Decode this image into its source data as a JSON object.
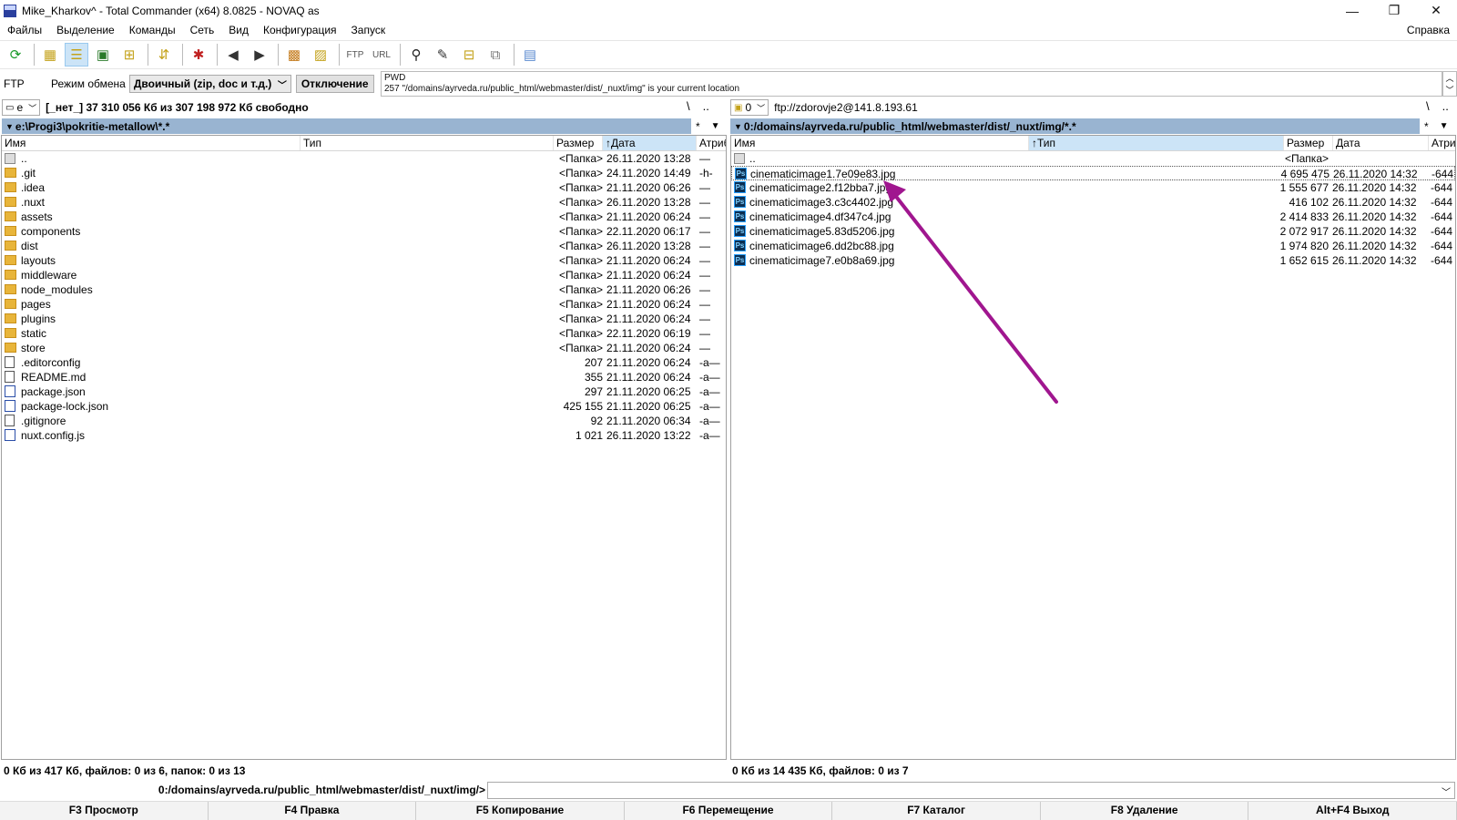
{
  "window": {
    "title": "Mike_Kharkov^ - Total Commander (x64) 8.0825 - NOVAQ as",
    "minimize": "—",
    "restore": "❐",
    "close": "✕"
  },
  "menu": {
    "items": [
      "Файлы",
      "Выделение",
      "Команды",
      "Сеть",
      "Вид",
      "Конфигурация",
      "Запуск"
    ],
    "help": "Справка"
  },
  "toolbar": {
    "icons": [
      "refresh-icon",
      "brief-view-icon",
      "full-view-icon",
      "thumbnails-icon",
      "tree-icon",
      "sync-icon",
      "pack-icon",
      "back-icon",
      "forward-icon",
      "pack-files-icon",
      "unpack-files-icon",
      "ftp-connect-icon",
      "url-connect-icon",
      "search-icon",
      "multi-rename-icon",
      "compare-dirs-icon",
      "sync-dirs-icon",
      "notepad-icon"
    ]
  },
  "ftp": {
    "label": "FTP",
    "mode_label": "Режим обмена",
    "mode_value": "Двоичный (zip, doc и т.д.)",
    "disconnect": "Отключение",
    "log_line1": "PWD",
    "log_line2": "257 \"/domains/ayrveda.ru/public_html/webmaster/dist/_nuxt/img\" is your current location"
  },
  "left": {
    "drive": "e",
    "drive_info": "[_нет_]  37 310 056 Кб из 307 198 972 Кб свободно",
    "nav_root": "\\",
    "nav_up": "..",
    "path": "e:\\Progi3\\pokritie-metallow\\*.*",
    "filter": "*",
    "filter_chev": "▼",
    "headers": {
      "name": "Имя",
      "type": "Тип",
      "size": "Размер",
      "date": "↑Дата",
      "attr": "Атриб"
    },
    "rows": [
      {
        "icon": "up",
        "name": "..",
        "type": "",
        "size": "<Папка>",
        "date": "26.11.2020 13:28",
        "attr": "—"
      },
      {
        "icon": "folder",
        "name": ".git",
        "type": "",
        "size": "<Папка>",
        "date": "24.11.2020 14:49",
        "attr": "-h-"
      },
      {
        "icon": "folder",
        "name": ".idea",
        "type": "",
        "size": "<Папка>",
        "date": "21.11.2020 06:26",
        "attr": "—"
      },
      {
        "icon": "folder",
        "name": ".nuxt",
        "type": "",
        "size": "<Папка>",
        "date": "26.11.2020 13:28",
        "attr": "—"
      },
      {
        "icon": "folder",
        "name": "assets",
        "type": "",
        "size": "<Папка>",
        "date": "21.11.2020 06:24",
        "attr": "—"
      },
      {
        "icon": "folder",
        "name": "components",
        "type": "",
        "size": "<Папка>",
        "date": "22.11.2020 06:17",
        "attr": "—"
      },
      {
        "icon": "folder",
        "name": "dist",
        "type": "",
        "size": "<Папка>",
        "date": "26.11.2020 13:28",
        "attr": "—"
      },
      {
        "icon": "folder",
        "name": "layouts",
        "type": "",
        "size": "<Папка>",
        "date": "21.11.2020 06:24",
        "attr": "—"
      },
      {
        "icon": "folder",
        "name": "middleware",
        "type": "",
        "size": "<Папка>",
        "date": "21.11.2020 06:24",
        "attr": "—"
      },
      {
        "icon": "folder",
        "name": "node_modules",
        "type": "",
        "size": "<Папка>",
        "date": "21.11.2020 06:26",
        "attr": "—"
      },
      {
        "icon": "folder",
        "name": "pages",
        "type": "",
        "size": "<Папка>",
        "date": "21.11.2020 06:24",
        "attr": "—"
      },
      {
        "icon": "folder",
        "name": "plugins",
        "type": "",
        "size": "<Папка>",
        "date": "21.11.2020 06:24",
        "attr": "—"
      },
      {
        "icon": "folder",
        "name": "static",
        "type": "",
        "size": "<Папка>",
        "date": "22.11.2020 06:19",
        "attr": "—"
      },
      {
        "icon": "folder",
        "name": "store",
        "type": "",
        "size": "<Папка>",
        "date": "21.11.2020 06:24",
        "attr": "—"
      },
      {
        "icon": "file",
        "name": ".editorconfig",
        "type": "",
        "size": "207",
        "date": "21.11.2020 06:24",
        "attr": "-a—"
      },
      {
        "icon": "file",
        "name": "README.md",
        "type": "",
        "size": "355",
        "date": "21.11.2020 06:24",
        "attr": "-a—"
      },
      {
        "icon": "json",
        "name": "package.json",
        "type": "",
        "size": "297",
        "date": "21.11.2020 06:25",
        "attr": "-a—"
      },
      {
        "icon": "json",
        "name": "package-lock.json",
        "type": "",
        "size": "425 155",
        "date": "21.11.2020 06:25",
        "attr": "-a—"
      },
      {
        "icon": "file",
        "name": ".gitignore",
        "type": "",
        "size": "92",
        "date": "21.11.2020 06:34",
        "attr": "-a—"
      },
      {
        "icon": "json",
        "name": "nuxt.config.js",
        "type": "",
        "size": "1 021",
        "date": "26.11.2020 13:22",
        "attr": "-a—"
      }
    ],
    "status": "0 Кб из 417 Кб, файлов: 0 из 6, папок: 0 из 13"
  },
  "right": {
    "drive": "0",
    "drive_info": "ftp://zdorovje2@141.8.193.61",
    "nav_root": "\\",
    "nav_up": "..",
    "path": "0:/domains/ayrveda.ru/public_html/webmaster/dist/_nuxt/img/*.*",
    "filter": "*",
    "filter_chev": "▼",
    "headers": {
      "name": "Имя",
      "type": "↑Тип",
      "size": "Размер",
      "date": "Дата",
      "attr": "Атриб"
    },
    "rows": [
      {
        "icon": "up",
        "name": "..",
        "type": "",
        "size": "<Папка>",
        "date": "",
        "attr": ""
      },
      {
        "icon": "ps",
        "name": "cinematicimage1.7e09e83.jpg",
        "type": "",
        "size": "4 695 475",
        "date": "26.11.2020 14:32",
        "attr": "-644"
      },
      {
        "icon": "ps",
        "name": "cinematicimage2.f12bba7.jpg",
        "type": "",
        "size": "1 555 677",
        "date": "26.11.2020 14:32",
        "attr": "-644"
      },
      {
        "icon": "ps",
        "name": "cinematicimage3.c3c4402.jpg",
        "type": "",
        "size": "416 102",
        "date": "26.11.2020 14:32",
        "attr": "-644"
      },
      {
        "icon": "ps",
        "name": "cinematicimage4.df347c4.jpg",
        "type": "",
        "size": "2 414 833",
        "date": "26.11.2020 14:32",
        "attr": "-644"
      },
      {
        "icon": "ps",
        "name": "cinematicimage5.83d5206.jpg",
        "type": "",
        "size": "2 072 917",
        "date": "26.11.2020 14:32",
        "attr": "-644"
      },
      {
        "icon": "ps",
        "name": "cinematicimage6.dd2bc88.jpg",
        "type": "",
        "size": "1 974 820",
        "date": "26.11.2020 14:32",
        "attr": "-644"
      },
      {
        "icon": "ps",
        "name": "cinematicimage7.e0b8a69.jpg",
        "type": "",
        "size": "1 652 615",
        "date": "26.11.2020 14:32",
        "attr": "-644"
      }
    ],
    "status": "0 Кб из 14 435 Кб, файлов: 0 из 7"
  },
  "cmdline": {
    "path": "0:/domains/ayrveda.ru/public_html/webmaster/dist/_nuxt/img/>"
  },
  "fkeys": [
    "F3 Просмотр",
    "F4 Правка",
    "F5 Копирование",
    "F6 Перемещение",
    "F7 Каталог",
    "F8 Удаление",
    "Alt+F4 Выход"
  ],
  "annotation": {
    "color": "#a0168f"
  }
}
